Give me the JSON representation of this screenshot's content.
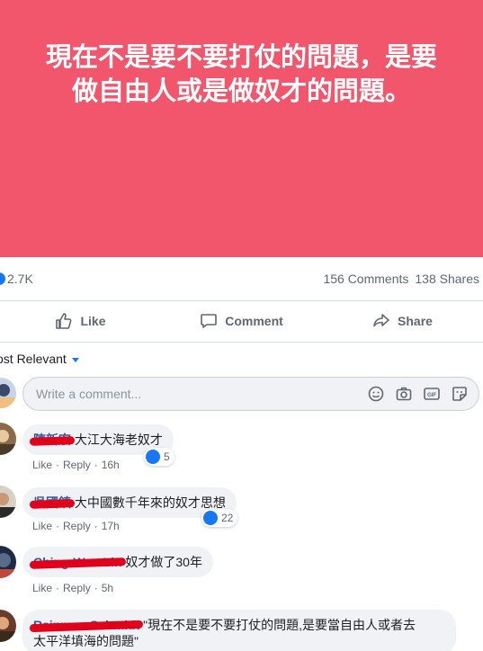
{
  "post": {
    "banner_lines": [
      "現在不是要不要打仗的問題，是要",
      "做自由人或是做奴才的問題。"
    ],
    "banner_color": "#f1566d"
  },
  "stats": {
    "reactions": "2.7K",
    "comments": "156 Comments",
    "shares": "138 Shares"
  },
  "actions": {
    "like": "Like",
    "comment": "Comment",
    "share": "Share"
  },
  "sort": {
    "label": "ost Relevant"
  },
  "composer": {
    "placeholder": "Write a comment...",
    "icons": [
      "emoji-icon",
      "camera-icon",
      "gif-icon",
      "sticker-icon"
    ]
  },
  "comments": [
    {
      "author": "陳新宏",
      "text": "大江大海老奴才",
      "like": "Like",
      "reply": "Reply",
      "time": "16h",
      "reactions": "5"
    },
    {
      "author": "吳國鎮",
      "text": "大中國數千年來的奴才思想",
      "like": "Like",
      "reply": "Reply",
      "time": "17h",
      "reactions": "22"
    },
    {
      "author": "Ching-Wen Lin",
      "text": "奴才做了30年",
      "like": "Like",
      "reply": "Reply",
      "time": "5h"
    },
    {
      "author": "Rainman Schmidt",
      "text_line1": "\"現在不是要不要打仗的問題,是要當自由人或者去",
      "text_line2": "太平洋填海的問題\""
    }
  ],
  "colors": {
    "accent": "#1877f2",
    "link": "#385898",
    "muted": "#606770",
    "redaction": "#e0001b"
  }
}
